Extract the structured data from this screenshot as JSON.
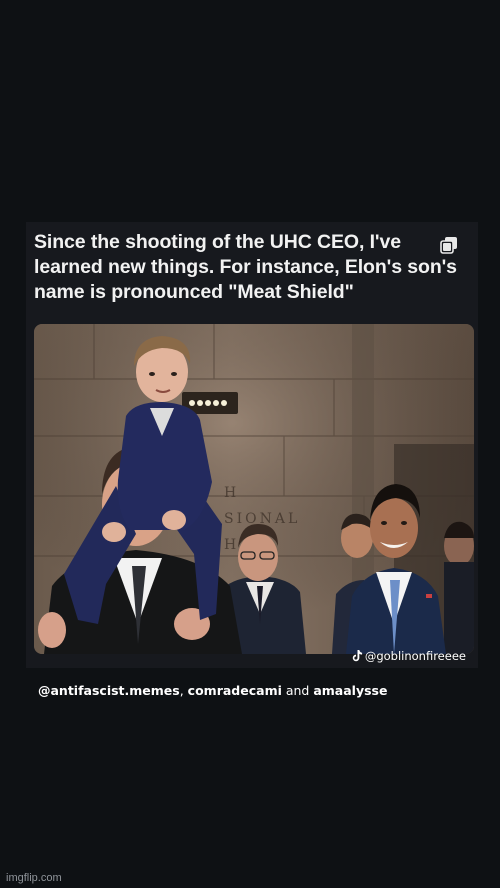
{
  "post": {
    "caption_line1": "Since the shooting of the UHC CEO, I've",
    "caption_line2": "learned new things. For instance, Elon's son's",
    "caption_line3": "name is pronounced \"Meat Shield\"",
    "multi_image_icon": "multiple-images-icon",
    "photo_sign_text_1": "H",
    "photo_sign_text_2": "SIONAL",
    "photo_sign_text_3": "H"
  },
  "watermark": {
    "icon": "tiktok-icon",
    "handle": "@goblinonfireeee"
  },
  "credits": {
    "user1": "@antifascist.memes",
    "sep1": ", ",
    "user2": "comradecami",
    "sep2": " and ",
    "user3": "amaalysse"
  },
  "footer": {
    "imgflip": "imgflip.com"
  },
  "colors": {
    "background": "#0e1114",
    "post_background": "#17191e",
    "caption_text": "#f2f2f2"
  }
}
